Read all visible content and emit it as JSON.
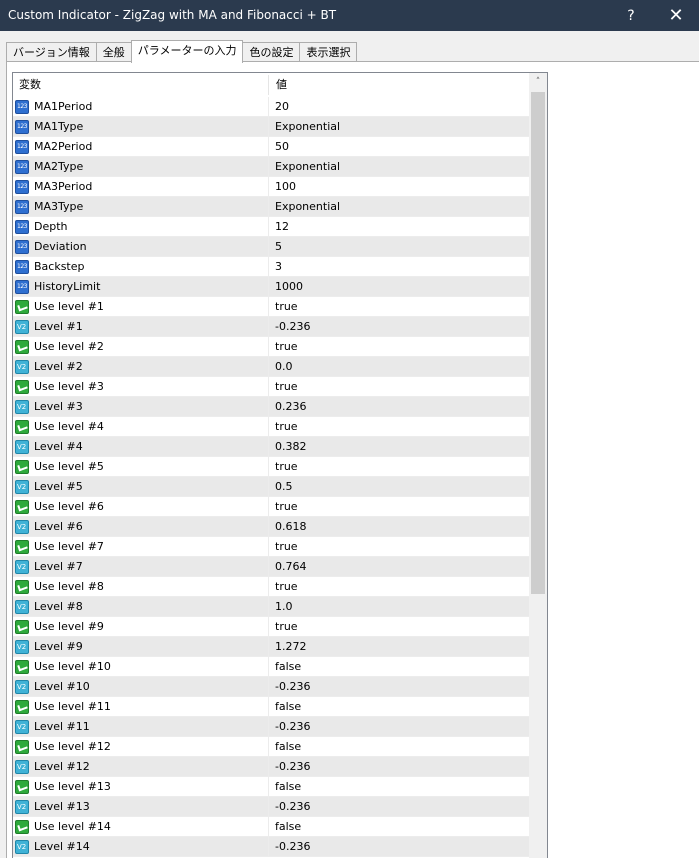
{
  "window": {
    "title": "Custom Indicator - ZigZag with MA and Fibonacci + BT",
    "help_label": "?",
    "close_label": "✕"
  },
  "tabs": [
    {
      "label": "バージョン情報"
    },
    {
      "label": "全般"
    },
    {
      "label": "パラメーターの入力",
      "active": true
    },
    {
      "label": "色の設定"
    },
    {
      "label": "表示選択"
    }
  ],
  "grid": {
    "columns": [
      "変数",
      "値"
    ],
    "rows": [
      {
        "icon": "number-icon",
        "name": "MA1Period",
        "value": "20"
      },
      {
        "icon": "number-icon",
        "name": "MA1Type",
        "value": "Exponential"
      },
      {
        "icon": "number-icon",
        "name": "MA2Period",
        "value": "50"
      },
      {
        "icon": "number-icon",
        "name": "MA2Type",
        "value": "Exponential"
      },
      {
        "icon": "number-icon",
        "name": "MA3Period",
        "value": "100"
      },
      {
        "icon": "number-icon",
        "name": "MA3Type",
        "value": "Exponential"
      },
      {
        "icon": "number-icon",
        "name": "Depth",
        "value": "12"
      },
      {
        "icon": "number-icon",
        "name": "Deviation",
        "value": "5"
      },
      {
        "icon": "number-icon",
        "name": "Backstep",
        "value": "3"
      },
      {
        "icon": "number-icon",
        "name": "HistoryLimit",
        "value": "1000"
      },
      {
        "icon": "bool-icon",
        "name": "Use level #1",
        "value": "true"
      },
      {
        "icon": "double-icon",
        "name": "Level #1",
        "value": "-0.236"
      },
      {
        "icon": "bool-icon",
        "name": "Use level #2",
        "value": "true"
      },
      {
        "icon": "double-icon",
        "name": "Level #2",
        "value": "0.0"
      },
      {
        "icon": "bool-icon",
        "name": "Use level #3",
        "value": "true"
      },
      {
        "icon": "double-icon",
        "name": "Level #3",
        "value": "0.236"
      },
      {
        "icon": "bool-icon",
        "name": "Use level #4",
        "value": "true"
      },
      {
        "icon": "double-icon",
        "name": "Level #4",
        "value": "0.382"
      },
      {
        "icon": "bool-icon",
        "name": "Use level #5",
        "value": "true"
      },
      {
        "icon": "double-icon",
        "name": "Level #5",
        "value": "0.5"
      },
      {
        "icon": "bool-icon",
        "name": "Use level #6",
        "value": "true"
      },
      {
        "icon": "double-icon",
        "name": "Level #6",
        "value": "0.618"
      },
      {
        "icon": "bool-icon",
        "name": "Use level #7",
        "value": "true"
      },
      {
        "icon": "double-icon",
        "name": "Level #7",
        "value": "0.764"
      },
      {
        "icon": "bool-icon",
        "name": "Use level #8",
        "value": "true"
      },
      {
        "icon": "double-icon",
        "name": "Level #8",
        "value": "1.0"
      },
      {
        "icon": "bool-icon",
        "name": "Use level #9",
        "value": "true"
      },
      {
        "icon": "double-icon",
        "name": "Level #9",
        "value": "1.272"
      },
      {
        "icon": "bool-icon",
        "name": "Use level #10",
        "value": "false"
      },
      {
        "icon": "double-icon",
        "name": "Level #10",
        "value": "-0.236"
      },
      {
        "icon": "bool-icon",
        "name": "Use level #11",
        "value": "false"
      },
      {
        "icon": "double-icon",
        "name": "Level #11",
        "value": "-0.236"
      },
      {
        "icon": "bool-icon",
        "name": "Use level #12",
        "value": "false"
      },
      {
        "icon": "double-icon",
        "name": "Level #12",
        "value": "-0.236"
      },
      {
        "icon": "bool-icon",
        "name": "Use level #13",
        "value": "false"
      },
      {
        "icon": "double-icon",
        "name": "Level #13",
        "value": "-0.236"
      },
      {
        "icon": "bool-icon",
        "name": "Use level #14",
        "value": "false"
      },
      {
        "icon": "double-icon",
        "name": "Level #14",
        "value": "-0.236"
      }
    ]
  },
  "scrollbar": {
    "up_arrow": "˄"
  }
}
